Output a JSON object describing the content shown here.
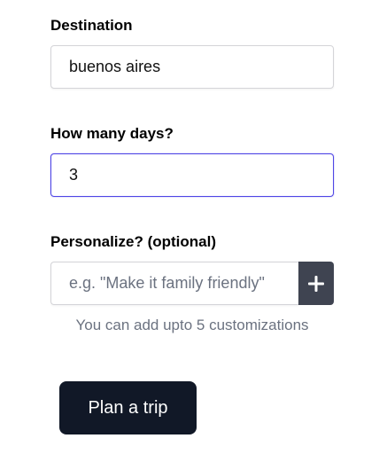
{
  "form": {
    "destination": {
      "label": "Destination",
      "value": "buenos aires"
    },
    "days": {
      "label": "How many days?",
      "value": "3"
    },
    "personalize": {
      "label": "Personalize? (optional)",
      "placeholder": "e.g. \"Make it family friendly\"",
      "value": "",
      "add_icon": "plus-icon",
      "hint": "You can add upto 5 customizations"
    },
    "submit_label": "Plan a trip"
  },
  "colors": {
    "focus_border": "#4f46e5",
    "add_button_bg": "#3f4451",
    "primary_button_bg": "#111827",
    "hint_text": "#6b7280"
  }
}
